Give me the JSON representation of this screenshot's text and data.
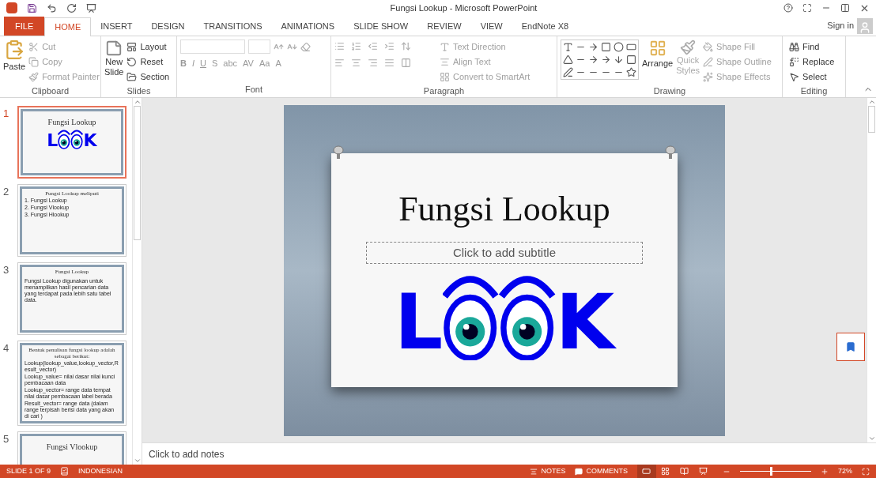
{
  "window": {
    "title": "Fungsi Lookup - Microsoft PowerPoint",
    "sign_in": "Sign in"
  },
  "tabs": [
    {
      "label": "FILE",
      "kind": "file",
      "selected": false
    },
    {
      "label": "HOME",
      "kind": "tab",
      "selected": true
    },
    {
      "label": "INSERT",
      "kind": "tab",
      "selected": false
    },
    {
      "label": "DESIGN",
      "kind": "tab",
      "selected": false
    },
    {
      "label": "TRANSITIONS",
      "kind": "tab",
      "selected": false
    },
    {
      "label": "ANIMATIONS",
      "kind": "tab",
      "selected": false
    },
    {
      "label": "SLIDE SHOW",
      "kind": "tab",
      "selected": false
    },
    {
      "label": "REVIEW",
      "kind": "tab",
      "selected": false
    },
    {
      "label": "VIEW",
      "kind": "tab",
      "selected": false
    },
    {
      "label": "EndNote X8",
      "kind": "tab",
      "selected": false
    }
  ],
  "ribbon": {
    "clipboard": {
      "label": "Clipboard",
      "paste": "Paste",
      "items": [
        {
          "label": "Cut",
          "disabled": true
        },
        {
          "label": "Copy",
          "disabled": true
        },
        {
          "label": "Format Painter",
          "disabled": true
        }
      ]
    },
    "slides": {
      "label": "Slides",
      "new_slide": [
        "New",
        "Slide"
      ],
      "items": [
        {
          "label": "Layout",
          "disabled": false
        },
        {
          "label": "Reset",
          "disabled": false
        },
        {
          "label": "Section",
          "disabled": false
        }
      ]
    },
    "font": {
      "label": "Font",
      "buttons": [
        "B",
        "I",
        "U",
        "S",
        "abc",
        "AV",
        "Aa",
        "A"
      ]
    },
    "paragraph": {
      "label": "Paragraph",
      "items": [
        {
          "label": "Text Direction",
          "disabled": true
        },
        {
          "label": "Align Text",
          "disabled": true
        },
        {
          "label": "Convert to SmartArt",
          "disabled": true
        }
      ]
    },
    "drawing": {
      "label": "Drawing",
      "arrange": "Arrange",
      "quick_styles": [
        "Quick",
        "Styles"
      ],
      "items": [
        {
          "label": "Shape Fill",
          "disabled": true
        },
        {
          "label": "Shape Outline",
          "disabled": true
        },
        {
          "label": "Shape Effects",
          "disabled": true
        }
      ]
    },
    "editing": {
      "label": "Editing",
      "items": [
        {
          "label": "Find",
          "kind": "find"
        },
        {
          "label": "Replace",
          "kind": "replace"
        },
        {
          "label": "Select",
          "kind": "select"
        }
      ]
    }
  },
  "thumbnails": [
    {
      "number": "1",
      "selected": true,
      "kind": "title",
      "title": "Fungsi Lookup",
      "logo": {
        "left": "L",
        "right": "K"
      }
    },
    {
      "number": "2",
      "selected": false,
      "kind": "list",
      "title": "Fungsi Lookup meliputi",
      "lines": [
        "1. Fungsi Lookup",
        "2. Fungsi Vlookup",
        "3. Fungsi Hlookup"
      ]
    },
    {
      "number": "3",
      "selected": false,
      "kind": "text",
      "title": "Fungsi Lookup",
      "lines": [
        "Fungsi Lookup digunakan untuk menampilkan hasil pencarian data yang terdapat pada lebih satu tabel data."
      ]
    },
    {
      "number": "4",
      "selected": false,
      "kind": "list",
      "title": "Bentuk penulisan fungsi lookup adalah sebagai berikut:",
      "lines": [
        "Lookup(lookup_value,lookup_vector,Result_vector)",
        "Lookup_value= nilai dasar nilai kunci pembacaan data",
        "Lookup_vector= range data tempat nilai dasar pembacaan label berada",
        "Result_vector= range data (dalam range terpisah berisi data yang akan di cari )"
      ]
    },
    {
      "number": "5",
      "selected": false,
      "kind": "title",
      "title": "Fungsi Vlookup"
    }
  ],
  "slide": {
    "title": "Fungsi Lookup",
    "subtitle_placeholder": "Click to add subtitle",
    "logo": {
      "left": "L",
      "right": "K"
    }
  },
  "notes": {
    "placeholder": "Click to add notes"
  },
  "status_bar": {
    "slide": "SLIDE 1 OF 9",
    "language": "INDONESIAN",
    "notes": "NOTES",
    "comments": "COMMENTS",
    "views": [
      {
        "kind": "normal",
        "selected": true
      },
      {
        "kind": "sorter",
        "selected": false
      },
      {
        "kind": "reading",
        "selected": false
      },
      {
        "kind": "show",
        "selected": false
      }
    ],
    "zoom": {
      "level": 0.42,
      "reading": "72%"
    }
  }
}
